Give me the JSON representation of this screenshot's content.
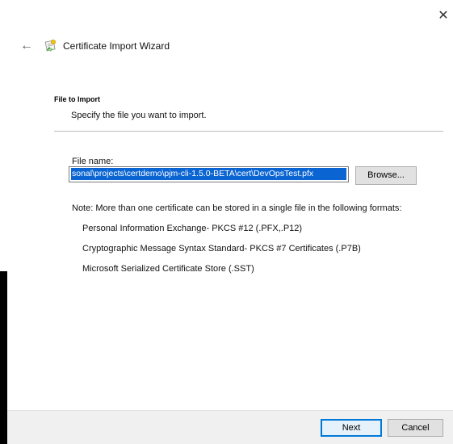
{
  "window": {
    "close_glyph": "✕",
    "back_glyph": "←",
    "title": "Certificate Import Wizard",
    "icon": "certificate-wizard-icon"
  },
  "section": {
    "title": "File to Import",
    "description": "Specify the file you want to import."
  },
  "file": {
    "label": "File name:",
    "value": "sonal\\projects\\certdemo\\pjm-cli-1.5.0-BETA\\cert\\DevOpsTest.pfx",
    "browse_label": "Browse..."
  },
  "note": "Note:  More than one certificate can be stored in a single file in the following formats:",
  "formats": [
    "Personal Information Exchange- PKCS #12 (.PFX,.P12)",
    "Cryptographic Message Syntax Standard- PKCS #7 Certificates (.P7B)",
    "Microsoft Serialized Certificate Store (.SST)"
  ],
  "footer": {
    "next_label": "Next",
    "cancel_label": "Cancel"
  },
  "colors": {
    "selection": "#0a64d2",
    "footer_bg": "#f0f0f0",
    "primary_border": "#0078d7"
  }
}
